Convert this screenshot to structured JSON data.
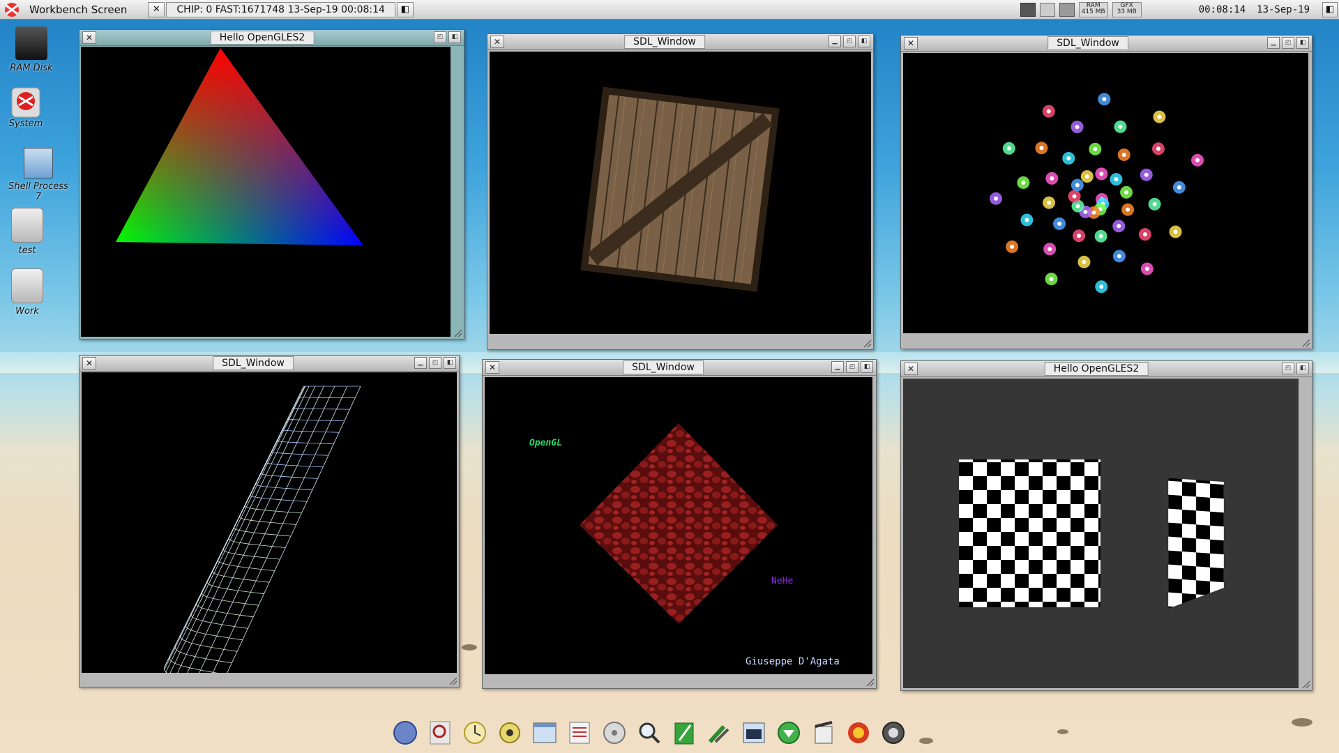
{
  "screen_title": "Workbench Screen",
  "screen_info": "CHIP:  0 FAST:1671748 13-Sep-19 00:08:14",
  "mem_ram": {
    "label": "RAM",
    "value": "415 MB"
  },
  "mem_gfx": {
    "label": "GFX",
    "value": "33 MB"
  },
  "clock": {
    "time": "00:08:14",
    "date": "13-Sep-19"
  },
  "desktop_icons": [
    {
      "label": "RAM Disk"
    },
    {
      "label": "System"
    },
    {
      "label": "Shell Process 7"
    },
    {
      "label": "test"
    },
    {
      "label": "Work"
    }
  ],
  "windows": [
    {
      "title": "Hello OpenGLES2",
      "content": "rgb-triangle"
    },
    {
      "title": "SDL_Window",
      "content": "wooden-crate"
    },
    {
      "title": "SDL_Window",
      "content": "particle-spiral"
    },
    {
      "title": "SDL_Window",
      "content": "wireframe-mesh"
    },
    {
      "title": "SDL_Window",
      "content": "bump-mapped-quad",
      "texts": {
        "opengl": "OpenGL",
        "nehe": "NeHe",
        "author": "Giuseppe D'Agata"
      }
    },
    {
      "title": "Hello OpenGLES2",
      "content": "checkerboards"
    }
  ],
  "dock_icons": [
    "amiga-orb-icon",
    "find-icon",
    "clock-icon",
    "prefs-icon",
    "window-icon",
    "notes-icon",
    "disk-icon",
    "search-icon",
    "edit-icon",
    "tools-icon",
    "shell-icon",
    "download-icon",
    "media-icon",
    "game-icon",
    "speaker-icon"
  ],
  "colors": {
    "window_active_tint": "#8cb5b7",
    "window_inactive": "#b8b8b8",
    "opengl_text": "#2fd36a",
    "nehe_text": "#8a2be2",
    "author_text": "#c8d8ff"
  }
}
